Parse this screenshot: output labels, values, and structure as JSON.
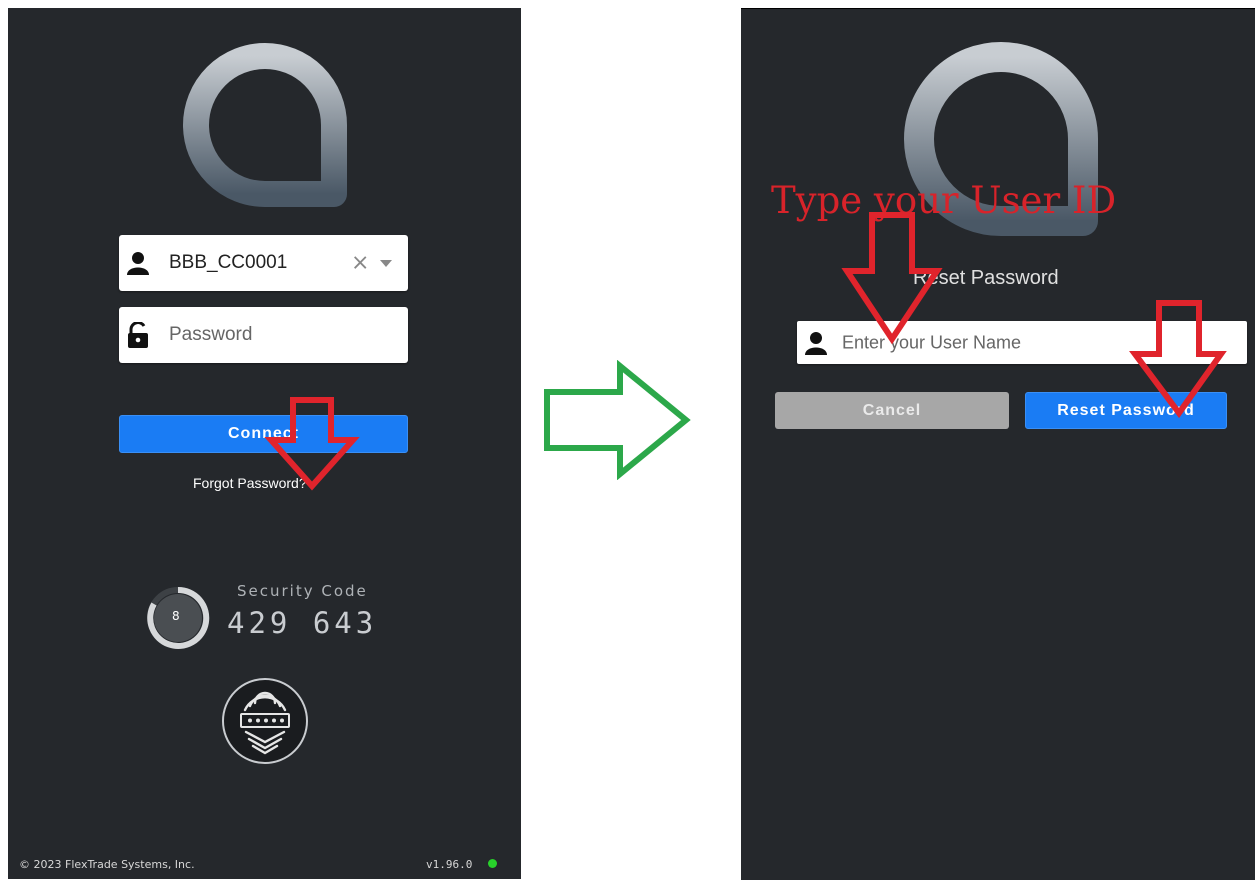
{
  "left_screen": {
    "username_value": "BBB_CC0001",
    "clear_symbol": "×",
    "password_placeholder": "Password",
    "connect_label": "Connect",
    "forgot_password_label": "Forgot Password?",
    "security_code_title": "Security Code",
    "security_code_value": "429 643",
    "countdown_value": "8",
    "copyright": "© 2023 FlexTrade Systems, Inc.",
    "version": "v1.96.0"
  },
  "right_screen": {
    "annotation": "Type your User ID",
    "title": "Reset Password",
    "username_placeholder": "Enter your User Name",
    "cancel_label": "Cancel",
    "reset_label": "Reset Password"
  },
  "colors": {
    "panel_bg": "#25282c",
    "primary_button": "#1a7cf4",
    "cancel_button": "#a7a7a7",
    "annotation_red": "#e0242c",
    "transition_arrow_green": "#2ca84a",
    "status_ok": "#28d12b"
  },
  "icons": [
    "user-icon",
    "unlock-icon",
    "chevron-down-icon",
    "fingerprint-icon",
    "countdown-ring-icon",
    "logo-icon",
    "red-arrow-icon",
    "green-arrow-icon"
  ]
}
